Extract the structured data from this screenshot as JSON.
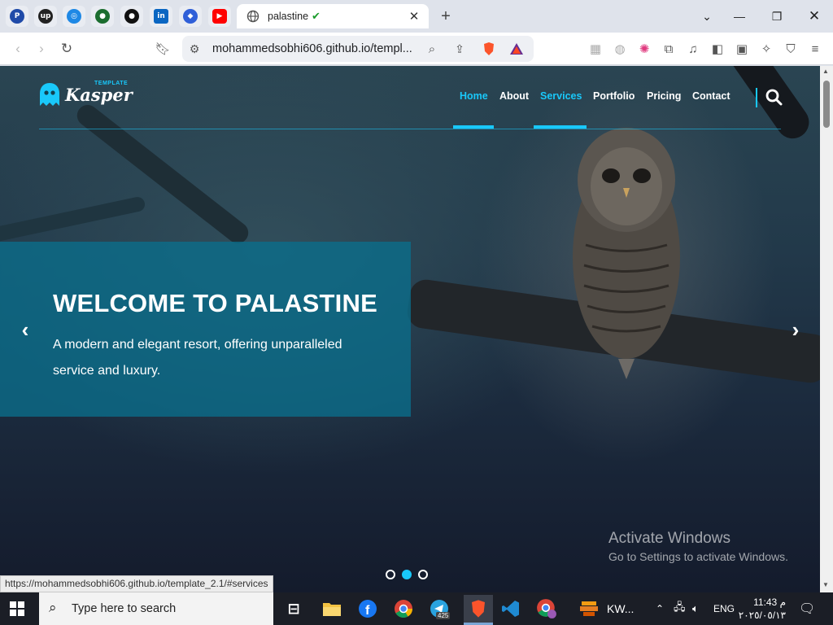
{
  "browser": {
    "pinned_tabs": [
      {
        "icon": "paypal-icon",
        "glyph": "P",
        "color": "#1f4aa8"
      },
      {
        "icon": "upwork-icon",
        "glyph": "up",
        "color": "#222222"
      },
      {
        "icon": "target-app-icon",
        "glyph": "◎",
        "color": "#1e88e5"
      },
      {
        "icon": "circle-app-icon",
        "glyph": "●",
        "color": "#1b6d2f"
      },
      {
        "icon": "github-icon",
        "glyph": "●",
        "color": "#111111"
      },
      {
        "icon": "linkedin-icon",
        "glyph": "in",
        "color": "#0a66c2"
      },
      {
        "icon": "crypto-app-icon",
        "glyph": "◆",
        "color": "#2f5fd8"
      },
      {
        "icon": "youtube-icon",
        "glyph": "▶",
        "color": "#ff0000"
      }
    ],
    "active_tab": {
      "title": "palastine",
      "check": "✔"
    },
    "url": "mohammedsobhi606.github.io/templ..."
  },
  "site": {
    "logo_text": "Kasper",
    "logo_sub": "TEMPLATE",
    "nav": [
      "Home",
      "About",
      "Services",
      "Portfolio",
      "Pricing",
      "Contact"
    ],
    "active_nav": "Home",
    "hovered_nav": "Services",
    "hero": {
      "title": "WELCOME TO PALASTINE",
      "description": "A modern and elegant resort, offering unparalleled service and luxury."
    },
    "slides": {
      "count": 3,
      "active": 2
    },
    "accent": "#19c8fa"
  },
  "overlay": {
    "activate_title": "Activate Windows",
    "activate_sub": "Go to Settings to activate Windows.",
    "status_url": "https://mohammedsobhi606.github.io/template_2.1/#services"
  },
  "taskbar": {
    "search_placeholder": "Type here to search",
    "telegram_badge": "425",
    "kw_label": "KW...",
    "lang": "ENG",
    "time": "11:43 م",
    "date": "٢٠٢٥/٠٥/١٣"
  }
}
